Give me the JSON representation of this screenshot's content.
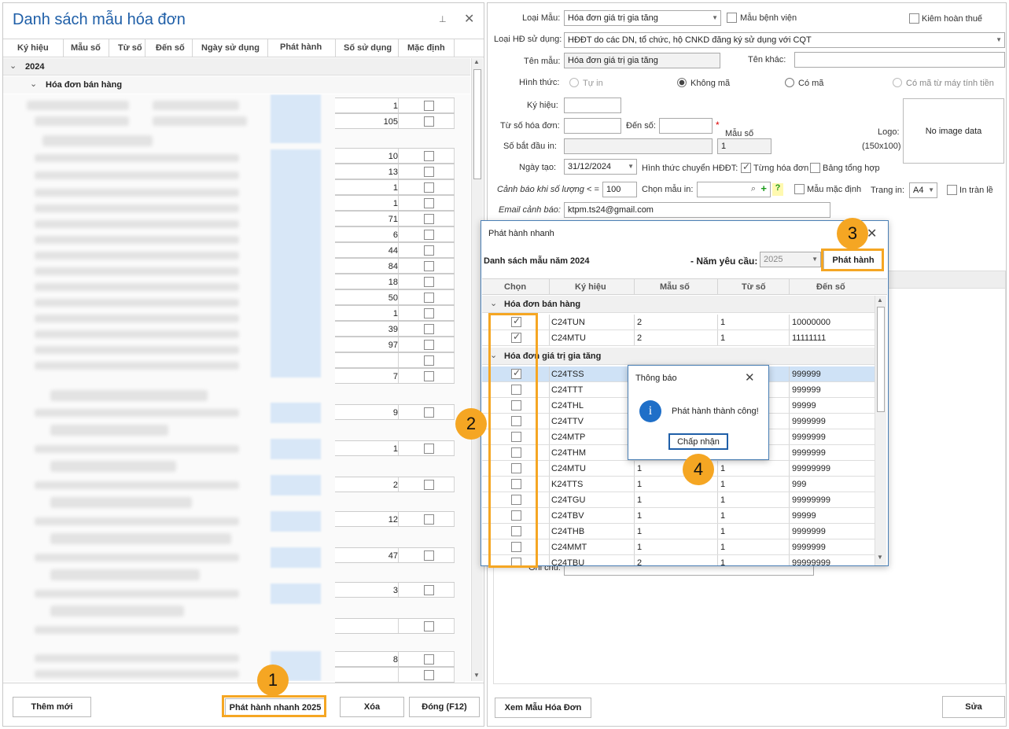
{
  "left_panel": {
    "title": "Danh sách mẫu hóa đơn",
    "columns": [
      "Ký hiệu",
      "Mẫu số",
      "Từ số",
      "Đến số",
      "Ngày sử dụng",
      "Phát hành",
      "Số sử dụng",
      "Mặc định"
    ],
    "group_year": "2024",
    "subgroup": "Hóa đơn bán hàng",
    "usage_rows": [
      {
        "value": "1",
        "checked": false
      },
      {
        "value": "105",
        "checked": false
      },
      {
        "value": "10",
        "checked": false
      },
      {
        "value": "13",
        "checked": false
      },
      {
        "value": "1",
        "checked": false
      },
      {
        "value": "1",
        "checked": false
      },
      {
        "value": "71",
        "checked": false
      },
      {
        "value": "6",
        "checked": false
      },
      {
        "value": "44",
        "checked": false
      },
      {
        "value": "84",
        "checked": false
      },
      {
        "value": "18",
        "checked": false
      },
      {
        "value": "50",
        "checked": false
      },
      {
        "value": "1",
        "checked": false
      },
      {
        "value": "39",
        "checked": false
      },
      {
        "value": "97",
        "checked": false
      },
      {
        "value": "",
        "checked": false
      },
      {
        "value": "7",
        "checked": false
      },
      {
        "value": "9",
        "checked": false
      },
      {
        "value": "1",
        "checked": false
      },
      {
        "value": "2",
        "checked": false
      },
      {
        "value": "12",
        "checked": false
      },
      {
        "value": "47",
        "checked": false
      },
      {
        "value": "3",
        "checked": false
      },
      {
        "value": "",
        "checked": false
      },
      {
        "value": "8",
        "checked": false
      },
      {
        "value": "",
        "checked": false
      }
    ],
    "buttons": {
      "add": "Thêm mới",
      "quick_issue": "Phát hành nhanh 2025",
      "delete": "Xóa",
      "close": "Đóng (F12)"
    }
  },
  "form": {
    "loai_mau_label": "Loại Mẫu:",
    "loai_mau_value": "Hóa đơn giá trị gia tăng",
    "mau_benh_vien": "Mẫu bệnh viện",
    "kiem_hoan_thue": "Kiêm hoàn thuế",
    "loai_hd_label": "Loại HĐ sử dụng:",
    "loai_hd_value": "HĐĐT do các DN, tổ chức, hộ CNKD đăng ký sử dụng với CQT",
    "ten_mau_label": "Tên mẫu:",
    "ten_mau_value": "Hóa đơn giá trị gia tăng",
    "ten_khac_label": "Tên khác:",
    "hinh_thuc_label": "Hình thức:",
    "hinh_thuc_options": [
      "Tự in",
      "Không mã",
      "Có mã",
      "Có mã từ máy tính tiền"
    ],
    "ky_hieu_label": "Ký hiệu:",
    "tu_so_label": "Từ số hóa đơn:",
    "den_so_label": "Đến số:",
    "mau_so_label": "Mẫu số",
    "so_bat_dau_label": "Số bắt đầu  in:",
    "mau_so_value": "1",
    "logo_label": "Logo:",
    "logo_size": "(150x100)",
    "no_image": "No image data",
    "ngay_tao_label": "Ngày tạo:",
    "ngay_tao_value": "31/12/2024",
    "hinh_thuc_chuyen_label": "Hình thức chuyển HĐĐT:",
    "tung_hoa_don": "Từng hóa đơn",
    "bang_tong_hop": "Bảng tổng hợp",
    "canh_bao_label": "Cảnh báo khi số lượng < =",
    "canh_bao_value": "100",
    "chon_mau_in_label": "Chọn mẫu in:",
    "mau_mac_dinh": "Mẫu mặc định",
    "trang_in_label": "Trang in:",
    "trang_in_value": "A4",
    "in_tran_le": "In tràn lề",
    "email_label": "Email cảnh báo:",
    "email_value": "ktpm.ts24@gmail.com",
    "ghi_chu_label": "Ghi chú:",
    "view_button": "Xem Mẫu Hóa Đơn",
    "edit_button": "Sửa"
  },
  "dialog": {
    "title": "Phát hành nhanh",
    "subtitle": "Danh sách mẫu năm 2024",
    "year_label": "- Năm yêu cầu:",
    "year_value": "2025",
    "issue_button": "Phát hành",
    "columns": [
      "Chọn",
      "Ký hiệu",
      "Mẫu số",
      "Từ số",
      "Đến số"
    ],
    "group1": "Hóa đơn bán hàng",
    "group1_rows": [
      {
        "ky_hieu": "C24TUN",
        "mau_so": "2",
        "tu_so": "1",
        "den_so": "10000000",
        "checked": true
      },
      {
        "ky_hieu": "C24MTU",
        "mau_so": "2",
        "tu_so": "1",
        "den_so": "11111111",
        "checked": true
      }
    ],
    "group2": "Hóa đơn giá trị gia tăng",
    "group2_rows": [
      {
        "ky_hieu": "C24TSS",
        "mau_so": "",
        "tu_so": "",
        "den_so": "999999",
        "checked": true
      },
      {
        "ky_hieu": "C24TTT",
        "mau_so": "",
        "tu_so": "",
        "den_so": "999999",
        "checked": false
      },
      {
        "ky_hieu": "C24THL",
        "mau_so": "",
        "tu_so": "",
        "den_so": "99999",
        "checked": false
      },
      {
        "ky_hieu": "C24TTV",
        "mau_so": "",
        "tu_so": "",
        "den_so": "9999999",
        "checked": false
      },
      {
        "ky_hieu": "C24MTP",
        "mau_so": "",
        "tu_so": "",
        "den_so": "9999999",
        "checked": false
      },
      {
        "ky_hieu": "C24THM",
        "mau_so": "",
        "tu_so": "",
        "den_so": "9999999",
        "checked": false
      },
      {
        "ky_hieu": "C24MTU",
        "mau_so": "1",
        "tu_so": "1",
        "den_so": "99999999",
        "checked": false
      },
      {
        "ky_hieu": "K24TTS",
        "mau_so": "1",
        "tu_so": "1",
        "den_so": "999",
        "checked": false
      },
      {
        "ky_hieu": "C24TGU",
        "mau_so": "1",
        "tu_so": "1",
        "den_so": "99999999",
        "checked": false
      },
      {
        "ky_hieu": "C24TBV",
        "mau_so": "1",
        "tu_so": "1",
        "den_so": "99999",
        "checked": false
      },
      {
        "ky_hieu": "C24THB",
        "mau_so": "1",
        "tu_so": "1",
        "den_so": "9999999",
        "checked": false
      },
      {
        "ky_hieu": "C24MMT",
        "mau_so": "1",
        "tu_so": "1",
        "den_so": "9999999",
        "checked": false
      },
      {
        "ky_hieu": "C24TBU",
        "mau_so": "2",
        "tu_so": "1",
        "den_so": "99999999",
        "checked": false
      }
    ]
  },
  "notify": {
    "title": "Thông báo",
    "message": "Phát hành thành công!",
    "ok": "Chấp nhận"
  },
  "steps": [
    "1",
    "2",
    "3",
    "4"
  ],
  "colors": {
    "title_blue": "#1f5fa8",
    "accent_orange": "#f5a623",
    "selected_row": "#cfe2f6"
  },
  "icons": {
    "pin": "pin-icon",
    "close": "close-icon",
    "search": "search-icon",
    "plus": "plus-icon",
    "help": "help-icon",
    "info": "info-icon"
  }
}
